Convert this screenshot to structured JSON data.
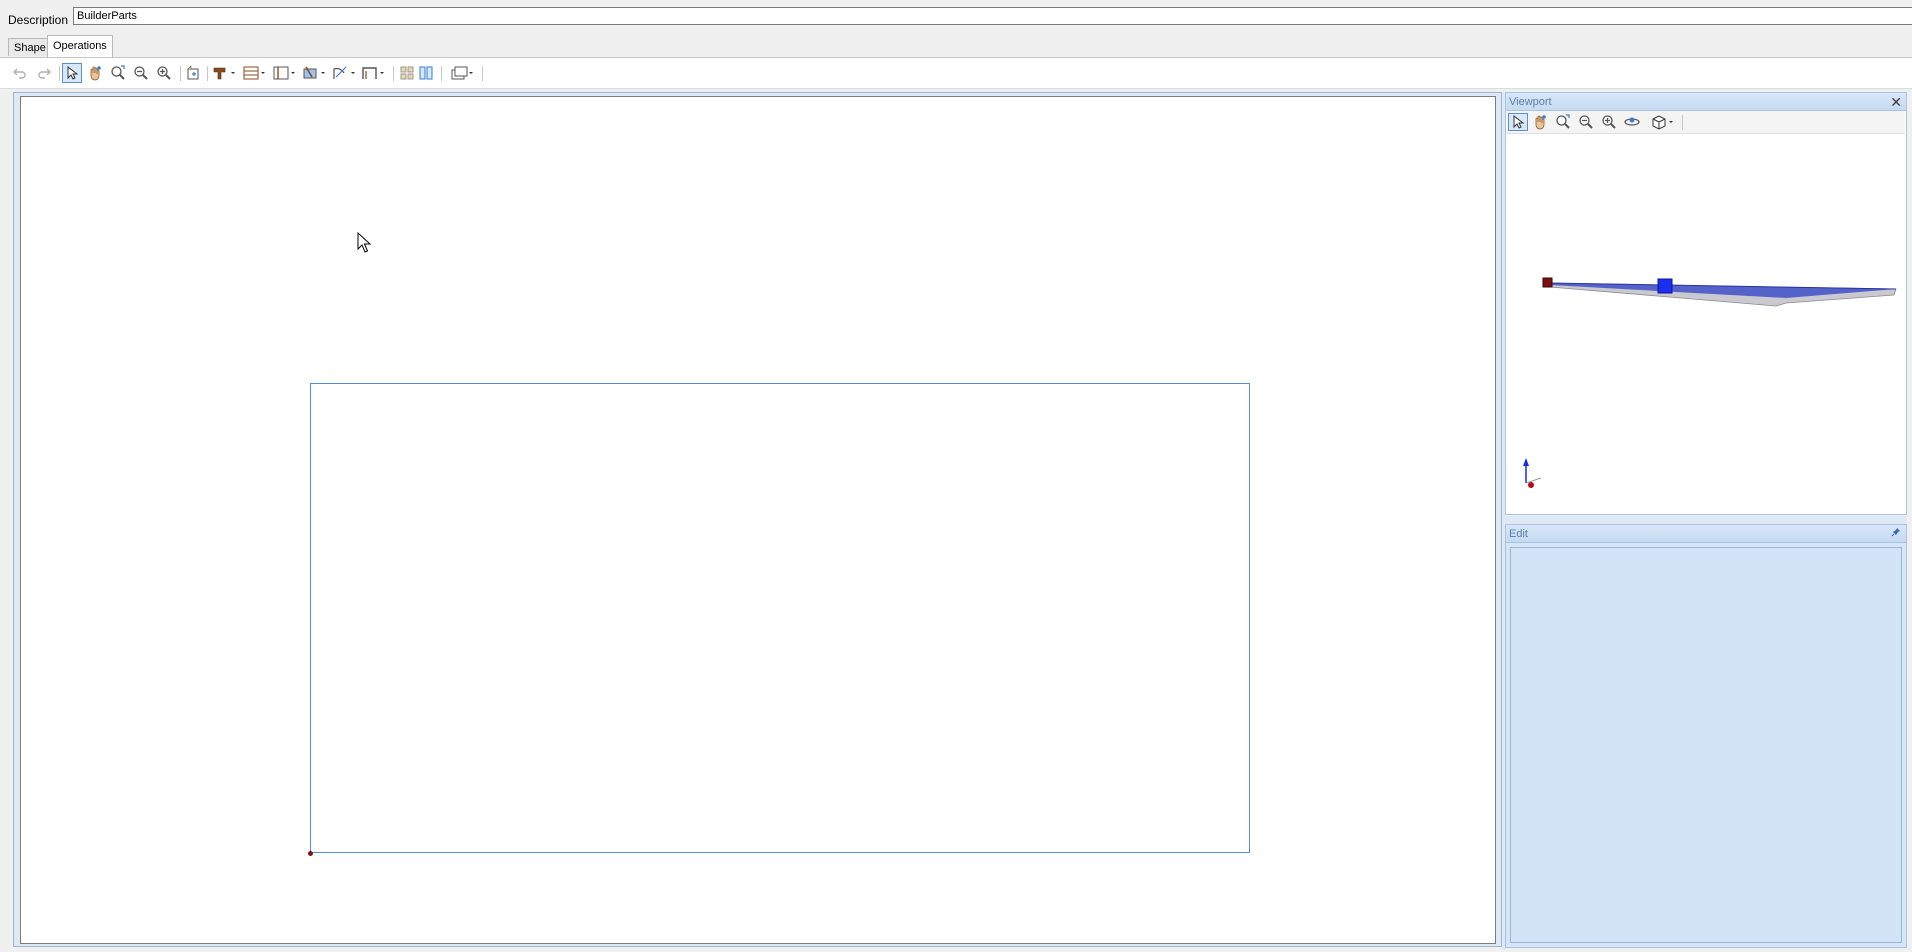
{
  "description": {
    "label": "Description",
    "value": "BuilderParts"
  },
  "tabs": [
    {
      "label": "Shape",
      "active": false
    },
    {
      "label": "Operations",
      "active": true
    }
  ],
  "toolbar": {
    "buttons": [
      "undo-icon",
      "redo-icon",
      "select-arrow-icon",
      "pan-hand-icon",
      "zoom-fit-icon",
      "zoom-out-icon",
      "zoom-in-icon",
      "add-shape-icon",
      "drill-tool-icon",
      "panel-layout-icon",
      "frame-icon",
      "cut-tool-icon",
      "curve-tool-icon",
      "arch-icon",
      "grid-icon",
      "split-view-icon",
      "view-display-icon"
    ]
  },
  "viewport": {
    "title": "Viewport",
    "close_glyph": "✕"
  },
  "edit": {
    "title": "Edit"
  },
  "colors": {
    "accent": "#4f8fd2",
    "panel_header_text": "#5d7ea7",
    "panel_bg": "#d6e6f9"
  }
}
